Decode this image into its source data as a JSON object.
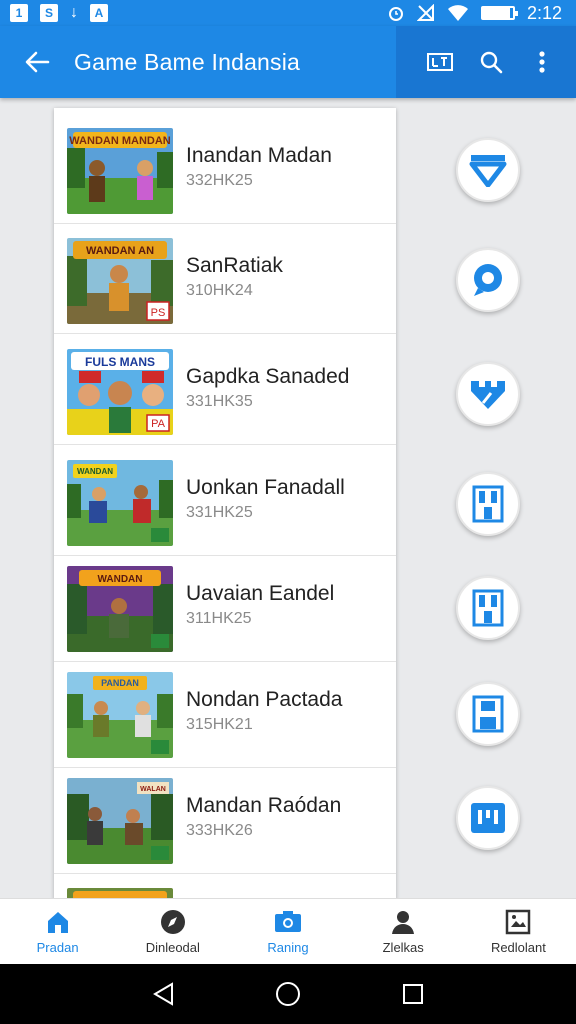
{
  "status": {
    "time": "2:12",
    "left_icons": [
      "1",
      "S",
      "download-arrow",
      "A"
    ],
    "battery_level": 0.9
  },
  "app_bar": {
    "title": "Game Bame Indansia",
    "icons": [
      "back-arrow-icon",
      "layout-icon",
      "search-icon",
      "more-vert-icon"
    ]
  },
  "list": [
    {
      "title": "Inandan Madan",
      "subtitle": "332HK25",
      "thumb_caption": "WANDAN MANDAN"
    },
    {
      "title": "SanRatiak",
      "subtitle": "310HK24",
      "thumb_caption": "WANDAN AN",
      "thumb_badge": "PS"
    },
    {
      "title": "Gapdka Sanaded",
      "subtitle": "331HK35",
      "thumb_caption": "FULS MANS",
      "thumb_badge": "PA"
    },
    {
      "title": "Uonkan Fanadall",
      "subtitle": "331HK25",
      "thumb_caption": "WANDAN"
    },
    {
      "title": "Uavaian Eandel",
      "subtitle": "311HK25",
      "thumb_caption": "WANDAN"
    },
    {
      "title": "Nondan Pactada",
      "subtitle": "315HK21",
      "thumb_caption": "PANDAN"
    },
    {
      "title": "Mandan Raódan",
      "subtitle": "333HK26",
      "thumb_caption": "WALAN"
    }
  ],
  "actions": [
    "triangle-down-icon",
    "location-pin-icon",
    "plug-icon",
    "save-icon",
    "save-icon",
    "save-icon",
    "grid-icon"
  ],
  "colors": {
    "primary": "#1e88e5",
    "primary_dark": "#1976d2"
  },
  "bottom_nav": [
    {
      "label": "Pradan",
      "icon": "home-icon",
      "active": true
    },
    {
      "label": "Dinleodal",
      "icon": "compass-icon"
    },
    {
      "label": "Raning",
      "icon": "camera-icon"
    },
    {
      "label": "Zlelkas",
      "icon": "person-icon"
    },
    {
      "label": "Redlolant",
      "icon": "image-icon"
    }
  ],
  "system_nav": [
    "back-triangle-icon",
    "home-circle-icon",
    "recents-square-icon"
  ]
}
